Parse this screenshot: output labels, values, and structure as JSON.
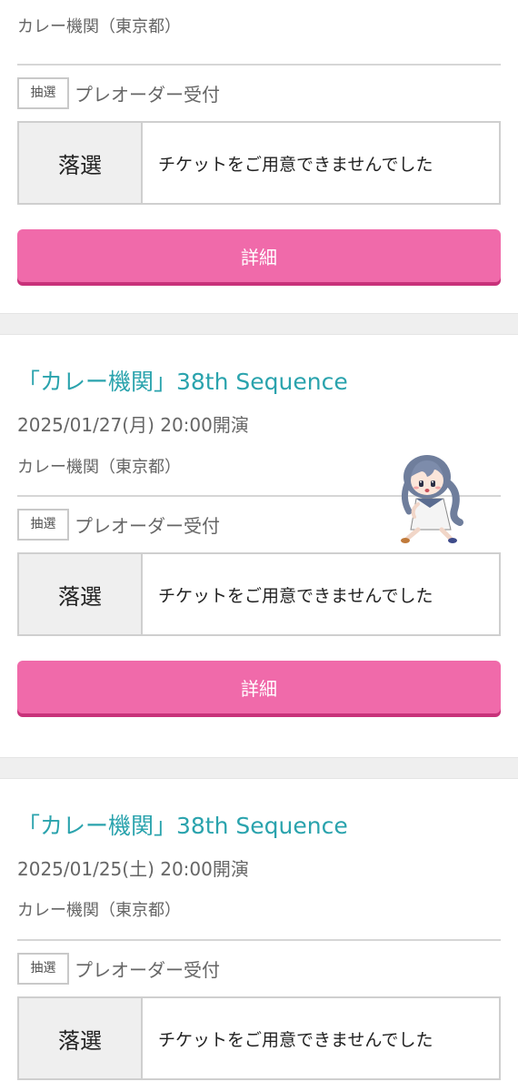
{
  "cards": [
    {
      "venue": "カレー機関（東京都）",
      "badge": "抽選",
      "type_label": "プレオーダー受付",
      "status": "落選",
      "message": "チケットをご用意できませんでした",
      "button": "詳細"
    },
    {
      "title": "「カレー機関」38th Sequence",
      "date": "2025/01/27(月) 20:00開演",
      "venue": "カレー機関（東京都）",
      "badge": "抽選",
      "type_label": "プレオーダー受付",
      "status": "落選",
      "message": "チケットをご用意できませんでした",
      "button": "詳細"
    },
    {
      "title": "「カレー機関」38th Sequence",
      "date": "2025/01/25(土) 20:00開演",
      "venue": "カレー機関（東京都）",
      "badge": "抽選",
      "type_label": "プレオーダー受付",
      "status": "落選",
      "message": "チケットをご用意できませんでした"
    }
  ],
  "colors": {
    "accent_title": "#2aa3ad",
    "button_pink": "#f06aaa",
    "button_shadow": "#c8327a",
    "section_gap": "#efefef"
  },
  "icons": {
    "mascot": "chibi-girl-mascot"
  }
}
